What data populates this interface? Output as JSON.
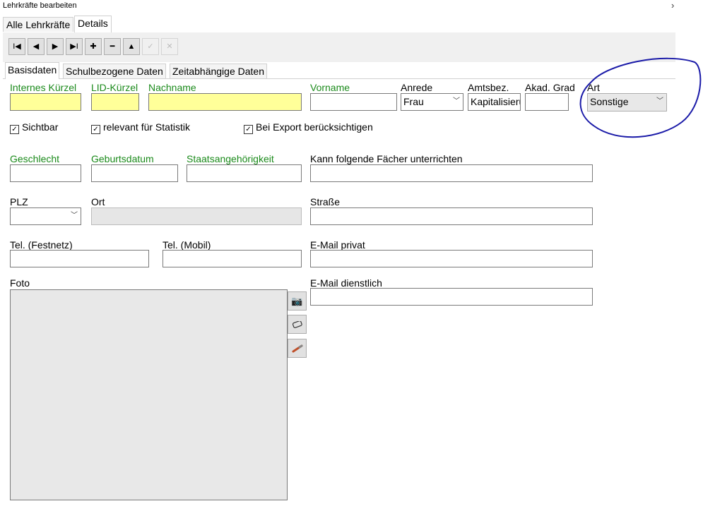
{
  "window": {
    "title": "Lehrkräfte bearbeiten"
  },
  "outer_tabs": [
    "Alle Lehrkräfte",
    "Details"
  ],
  "toolbar": {
    "buttons": [
      "first-icon",
      "prev-icon",
      "next-icon",
      "last-icon",
      "plus-icon",
      "minus-icon",
      "up-icon",
      "check-icon",
      "cancel-icon"
    ],
    "glyphs": [
      "I◀",
      "◀",
      "▶",
      "▶I",
      "✚",
      "━",
      "▲",
      "✓",
      "✕"
    ]
  },
  "inner_tabs": [
    "Basisdaten",
    "Schulbezogene Daten",
    "Zeitabhängige Daten"
  ],
  "form": {
    "internes_kuerzel": {
      "label": "Internes Kürzel",
      "value": ""
    },
    "lid_kuerzel": {
      "label": "LID-Kürzel",
      "value": ""
    },
    "nachname": {
      "label": "Nachname",
      "value": ""
    },
    "vorname": {
      "label": "Vorname",
      "value": ""
    },
    "anrede": {
      "label": "Anrede",
      "value": "Frau"
    },
    "amtsbez": {
      "label": "Amtsbez.",
      "value": "Kapitalisieru"
    },
    "akad_grad": {
      "label": "Akad. Grad",
      "value": ""
    },
    "art": {
      "label": "Art",
      "value": "Sonstige"
    },
    "checks": [
      {
        "label": "Sichtbar",
        "checked": "☑"
      },
      {
        "label": "relevant für Statistik",
        "checked": "☑"
      },
      {
        "label": "Bei Export berücksichtigen",
        "checked": "☑"
      }
    ],
    "geschlecht": {
      "label": "Geschlecht"
    },
    "geburtsdatum": {
      "label": "Geburtsdatum"
    },
    "staatsangehoerigkeit": {
      "label": "Staatsangehörigkeit"
    },
    "faecher": {
      "label": "Kann folgende Fächer unterrichten"
    },
    "plz": {
      "label": "PLZ"
    },
    "ort": {
      "label": "Ort"
    },
    "strasse": {
      "label": "Straße"
    },
    "tel_festnetz": {
      "label": "Tel. (Festnetz)"
    },
    "tel_mobil": {
      "label": "Tel. (Mobil)"
    },
    "email_privat": {
      "label": "E-Mail privat"
    },
    "email_dienstlich": {
      "label": "E-Mail dienstlich"
    },
    "foto": {
      "label": "Foto"
    }
  },
  "photo_buttons": [
    "camera-icon",
    "eraser-icon",
    "brush-icon"
  ],
  "highlight_color": "#1a1aa8"
}
